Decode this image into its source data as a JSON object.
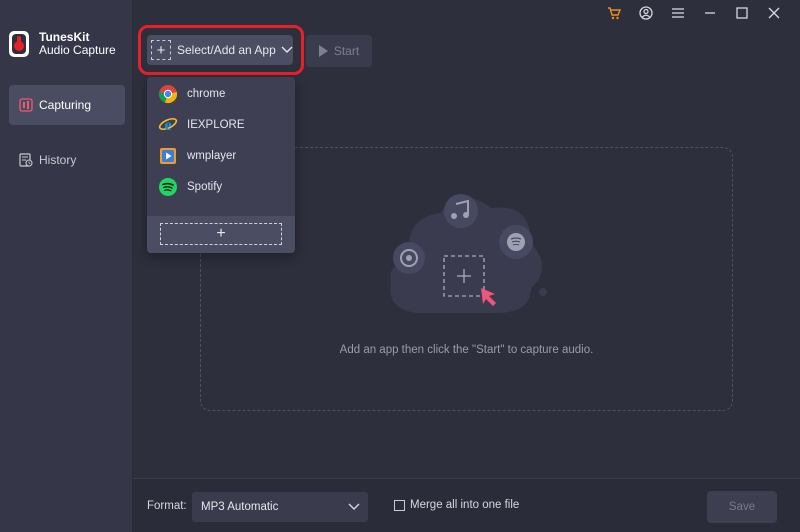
{
  "brand": {
    "line1": "TunesKit",
    "line2": "Audio Capture"
  },
  "sidebar": {
    "items": [
      {
        "label": "Capturing",
        "active": true,
        "icon": "capture-icon"
      },
      {
        "label": "History",
        "active": false,
        "icon": "history-icon"
      }
    ]
  },
  "window_controls": [
    "cart-icon",
    "account-icon",
    "menu-icon",
    "minimize-icon",
    "maximize-icon",
    "close-icon"
  ],
  "toolbar": {
    "select_app_label": "Select/Add an App",
    "start_label": "Start"
  },
  "dropdown": {
    "apps": [
      {
        "label": "chrome",
        "icon": "chrome-icon"
      },
      {
        "label": "IEXPLORE",
        "icon": "internet-explorer-icon"
      },
      {
        "label": "wmplayer",
        "icon": "windows-media-player-icon"
      },
      {
        "label": "Spotify",
        "icon": "spotify-icon"
      }
    ],
    "add_label": "+"
  },
  "main": {
    "hint": "Add an app then click the \"Start\" to capture audio."
  },
  "bottom": {
    "format_label": "Format:",
    "format_value": "MP3 Automatic",
    "merge_label": "Merge all into one file",
    "save_label": "Save"
  },
  "colors": {
    "highlight": "#e8202a",
    "accent_cart": "#f08a24",
    "cursor_arrow": "#f0567a"
  }
}
